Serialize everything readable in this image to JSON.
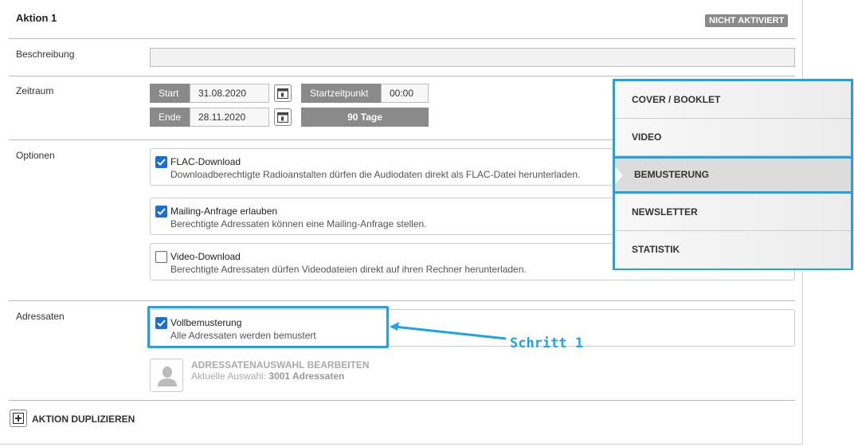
{
  "header": {
    "title": "Aktion 1",
    "status_badge": "NICHT AKTIVIERT"
  },
  "labels": {
    "beschreibung": "Beschreibung",
    "zeitraum": "Zeitraum",
    "optionen": "Optionen",
    "adressaten": "Adressaten"
  },
  "zeitraum": {
    "start_label": "Start",
    "start_value": "31.08.2020",
    "end_label": "Ende",
    "end_value": "28.11.2020",
    "startzeitpunkt_label": "Startzeitpunkt",
    "startzeitpunkt_value": "00:00",
    "duration": "90 Tage"
  },
  "options": [
    {
      "title": "FLAC-Download",
      "subtitle": "Downloadberechtigte Radioanstalten dürfen die Audiodaten direkt als FLAC-Datei herunterladen.",
      "checked": true
    },
    {
      "title": "Mailing-Anfrage erlauben",
      "subtitle": "Berechtigte Adressaten können eine Mailing-Anfrage stellen.",
      "checked": true
    },
    {
      "title": "Video-Download",
      "subtitle": "Berechtigte Adressaten dürfen Videodateien direkt auf ihren Rechner herunterladen.",
      "checked": false
    }
  ],
  "adressaten": {
    "option": {
      "title": "Vollbemusterung",
      "subtitle": "Alle Adressaten werden bemustert",
      "checked": true
    },
    "edit_title": "ADRESSATENAUSWAHL BEARBEITEN",
    "selection_prefix": "Aktuelle Auswahl:",
    "selection_value": "3001 Adressaten"
  },
  "duplicate_label": "AKTION DUPLIZIEREN",
  "menu": {
    "items": [
      {
        "label": "COVER / BOOKLET",
        "active": false
      },
      {
        "label": "VIDEO",
        "active": false
      },
      {
        "label": "BEMUSTERUNG",
        "active": true
      },
      {
        "label": "NEWSLETTER",
        "active": false
      },
      {
        "label": "STATISTIK",
        "active": false
      }
    ]
  },
  "annotation": {
    "text": "Schritt 1"
  },
  "icons": {
    "calendar": "calendar-icon",
    "user": "user-silhouette-icon",
    "plus": "plus-square-icon",
    "check": "checkmark-icon"
  },
  "colors": {
    "accent": "#1ca4e4",
    "checkbox": "#1a6fd4",
    "label_bg": "#8a8a8a"
  }
}
